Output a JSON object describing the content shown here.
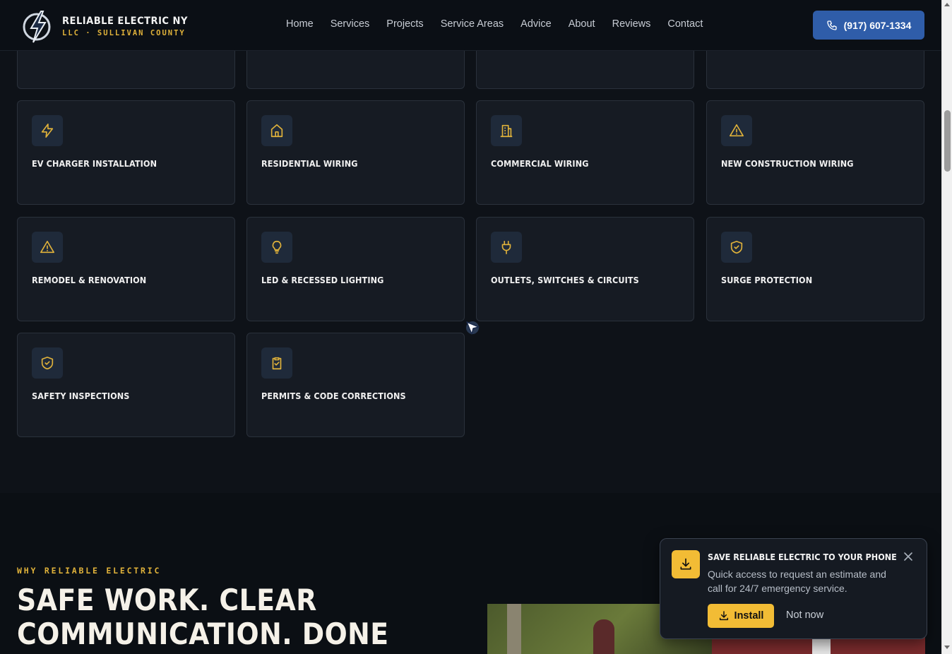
{
  "brand": {
    "name": "RELIABLE ELECTRIC NY",
    "sub": "LLC · SULLIVAN COUNTY"
  },
  "nav": [
    "Home",
    "Services",
    "Projects",
    "Service Areas",
    "Advice",
    "About",
    "Reviews",
    "Contact"
  ],
  "call_button": {
    "label": "(917) 607-1334",
    "icon": "phone-icon"
  },
  "services": [
    {
      "label": "EV CHARGER INSTALLATION",
      "icon": "bolt-icon"
    },
    {
      "label": "RESIDENTIAL WIRING",
      "icon": "home-icon"
    },
    {
      "label": "COMMERCIAL WIRING",
      "icon": "building-icon"
    },
    {
      "label": "NEW CONSTRUCTION WIRING",
      "icon": "warning-icon"
    },
    {
      "label": "REMODEL & RENOVATION",
      "icon": "warning-icon"
    },
    {
      "label": "LED & RECESSED LIGHTING",
      "icon": "lightbulb-icon"
    },
    {
      "label": "OUTLETS, SWITCHES & CIRCUITS",
      "icon": "plug-icon"
    },
    {
      "label": "SURGE PROTECTION",
      "icon": "shield-check-icon"
    },
    {
      "label": "SAFETY INSPECTIONS",
      "icon": "shield-check-icon"
    },
    {
      "label": "PERMITS & CODE CORRECTIONS",
      "icon": "clipboard-check-icon"
    }
  ],
  "why": {
    "eyebrow": "WHY RELIABLE ELECTRIC",
    "headline_line1": "SAFE WORK. CLEAR",
    "headline_line2": "COMMUNICATION. DONE RIGHT."
  },
  "install_popup": {
    "title": "SAVE RELIABLE ELECTRIC TO YOUR PHONE",
    "description": "Quick access to request an estimate and call for 24/7 emergency service.",
    "install_label": "Install",
    "dismiss_label": "Not now"
  },
  "colors": {
    "accent": "#e0b23a",
    "button_blue": "#2f5da9",
    "card_bg": "#161b23",
    "icon_bg": "#1f2a3a"
  }
}
